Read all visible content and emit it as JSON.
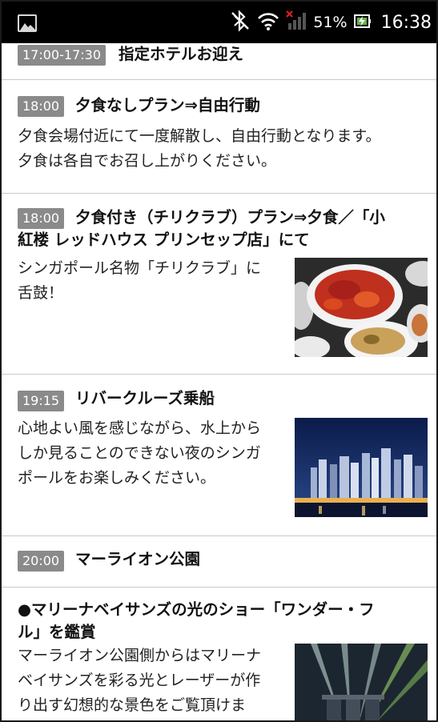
{
  "status_bar": {
    "battery_percent": "51%",
    "time": "16:38",
    "icons": [
      "gallery-icon",
      "bluetooth-off-icon",
      "wifi-icon",
      "signal-icon",
      "battery-charging-icon"
    ]
  },
  "schedule": [
    {
      "time": "17:00-17:30",
      "title": "指定ホテルお迎え"
    },
    {
      "time": "18:00",
      "title": "夕食なしプラン⇒自由行動",
      "desc": [
        "夕食会場付近にて一度解散し、自由行動となります。",
        "夕食は各自でお召し上がりください。"
      ]
    },
    {
      "time": "18:00",
      "title": [
        "夕食付き（チリクラブ）プラン⇒夕食／「小",
        "紅楼 レッドハウス プリンセップ店」にて"
      ],
      "desc": [
        "シンガポール名物「チリクラブ」に",
        "舌鼓！"
      ],
      "image": "chili-crab-dish-photo"
    },
    {
      "time": "19:15",
      "title": "リバークルーズ乗船",
      "desc": [
        "心地よい風を感じながら、水上から",
        "しか見ることのできない夜のシンガ",
        "ポールをお楽しみください。"
      ],
      "image": "singapore-night-skyline-photo"
    },
    {
      "time": "20:00",
      "title": "マーライオン公園"
    },
    {
      "title": [
        "●マリーナベイサンズの光のショー「ワンダー・フ",
        "ル」を鑑賞"
      ],
      "desc": [
        "マーライオン公園側からはマリーナ",
        "ベイサンズを彩る光とレーザーが作",
        "り出す幻想的な景色をご覧頂けま"
      ],
      "image": "marina-bay-light-show-photo"
    }
  ]
}
